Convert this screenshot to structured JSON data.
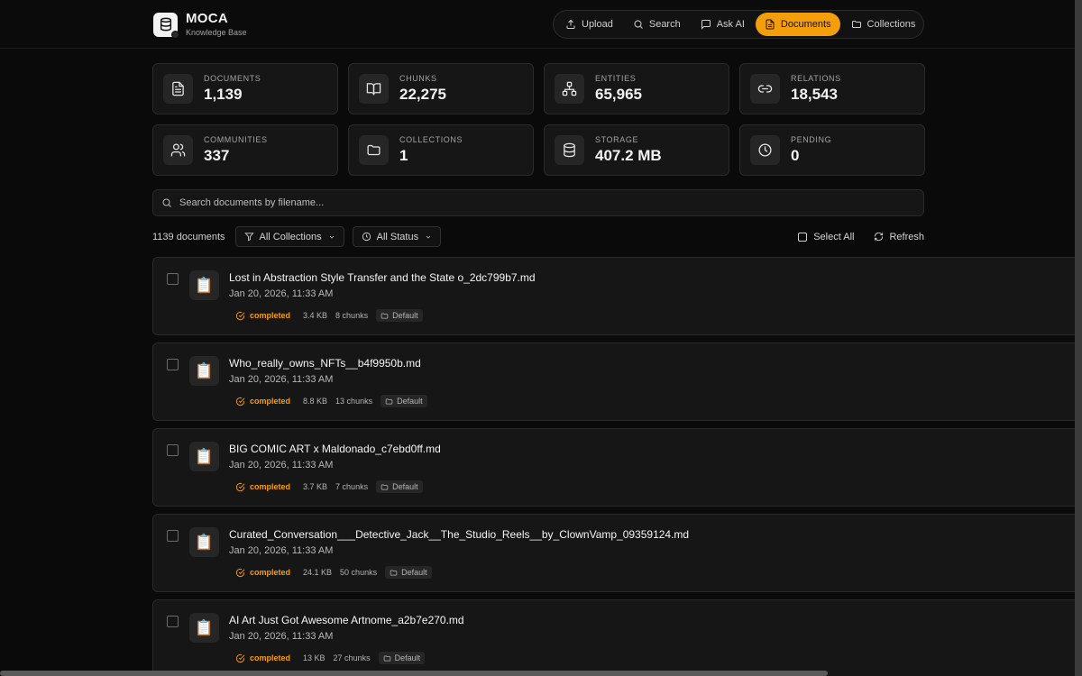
{
  "app": {
    "name": "MOCA",
    "subtitle": "Knowledge Base"
  },
  "nav": [
    {
      "label": "Upload",
      "icon": "upload-icon"
    },
    {
      "label": "Search",
      "icon": "search-icon"
    },
    {
      "label": "Ask AI",
      "icon": "chat-icon"
    },
    {
      "label": "Documents",
      "icon": "document-icon",
      "active": true
    },
    {
      "label": "Collections",
      "icon": "folder-icon"
    }
  ],
  "stats": [
    {
      "label": "Documents",
      "value": "1,139",
      "icon": "document-icon"
    },
    {
      "label": "Chunks",
      "value": "22,275",
      "icon": "book-icon"
    },
    {
      "label": "Entities",
      "value": "65,965",
      "icon": "network-icon"
    },
    {
      "label": "Relations",
      "value": "18,543",
      "icon": "link-icon"
    },
    {
      "label": "Communities",
      "value": "337",
      "icon": "users-icon"
    },
    {
      "label": "Collections",
      "value": "1",
      "icon": "folder-icon"
    },
    {
      "label": "Storage",
      "value": "407.2 MB",
      "icon": "database-icon"
    },
    {
      "label": "Pending",
      "value": "0",
      "icon": "clock-icon"
    }
  ],
  "search": {
    "placeholder": "Search documents by filename..."
  },
  "toolbar": {
    "count": "1139 documents",
    "collection_filter": "All Collections",
    "status_filter": "All Status",
    "select_all": "Select All",
    "refresh": "Refresh"
  },
  "documents": [
    {
      "name": "Lost in Abstraction Style Transfer and the State o_2dc799b7.md",
      "date": "Jan 20, 2026, 11:33 AM",
      "status": "completed",
      "size": "3.4 KB",
      "chunks": "8 chunks",
      "collection": "Default"
    },
    {
      "name": "Who_really_owns_NFTs__b4f9950b.md",
      "date": "Jan 20, 2026, 11:33 AM",
      "status": "completed",
      "size": "8.8 KB",
      "chunks": "13 chunks",
      "collection": "Default"
    },
    {
      "name": "BIG COMIC ART x Maldonado_c7ebd0ff.md",
      "date": "Jan 20, 2026, 11:33 AM",
      "status": "completed",
      "size": "3.7 KB",
      "chunks": "7 chunks",
      "collection": "Default"
    },
    {
      "name": "Curated_Conversation___Detective_Jack__The_Studio_Reels__by_ClownVamp_09359124.md",
      "date": "Jan 20, 2026, 11:33 AM",
      "status": "completed",
      "size": "24.1 KB",
      "chunks": "50 chunks",
      "collection": "Default"
    },
    {
      "name": "AI Art Just Got Awesome Artnome_a2b7e270.md",
      "date": "Jan 20, 2026, 11:33 AM",
      "status": "completed",
      "size": "13 KB",
      "chunks": "27 chunks",
      "collection": "Default"
    }
  ],
  "colors": {
    "accent": "#f59e0b",
    "background": "#0a0a0a",
    "card": "#161616"
  }
}
